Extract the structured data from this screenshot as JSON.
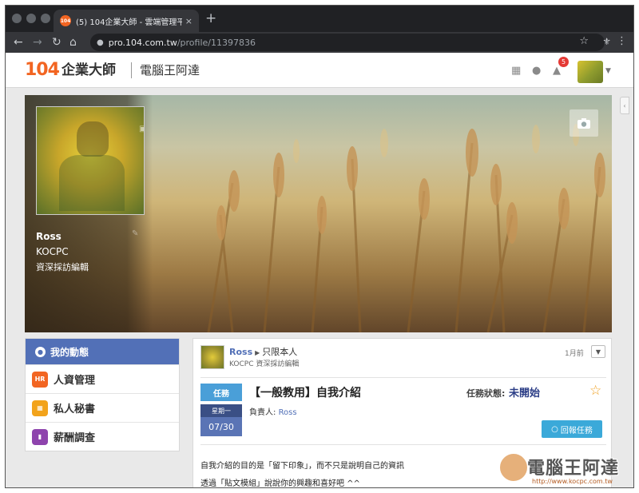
{
  "browser": {
    "tab_title": "(5) 104企業大師 - 雲端管理平台",
    "favicon_text": "104",
    "close_icon": "×",
    "new_tab_icon": "+",
    "url_host": "pro.104.com.tw",
    "url_path": "/profile/11397836",
    "nav_icons": [
      "back-arrow-icon",
      "forward-arrow-icon",
      "reload-icon",
      "home-icon"
    ]
  },
  "header": {
    "logo_num": "104",
    "logo_text": "企業大師",
    "company": "電腦王阿達",
    "notification_count": "5"
  },
  "profile": {
    "name": "Ross",
    "company": "KOCPC",
    "job_title": "資深採訪編輯"
  },
  "left_menu": {
    "active": "我的動態",
    "items": [
      {
        "label": "人資管理",
        "icon_text": "HR",
        "color": "#f26522"
      },
      {
        "label": "私人秘書",
        "icon_text": "",
        "color": "#f2a31b"
      },
      {
        "label": "薪酬調查",
        "icon_text": "",
        "color": "#8e44ad"
      }
    ]
  },
  "post": {
    "author": "Ross",
    "scope": "只限本人",
    "author_sub": "KOCPC 資深採訪編輯",
    "time": "1月前",
    "tag": "任務",
    "weekday": "星期一",
    "date": "07/30",
    "title": "【一般教用】自我介紹",
    "status_label": "任務狀態:",
    "status_value": "未開始",
    "owner_label": "負責人:",
    "owner": "Ross",
    "reply_label": "回報任務",
    "body_line1": "自我介紹的目的是「留下印象」，而不只是說明自己的資訊",
    "body_line2": "透過「貼文模組」說說你的興趣和喜好吧 ^^"
  },
  "watermark": {
    "text": "電腦王阿達",
    "url": "http://www.kocpc.com.tw"
  },
  "colors": {
    "accent_blue": "#5270b7",
    "task_blue": "#4a9fd8",
    "brand_orange": "#f26522",
    "star": "#f0a020"
  }
}
